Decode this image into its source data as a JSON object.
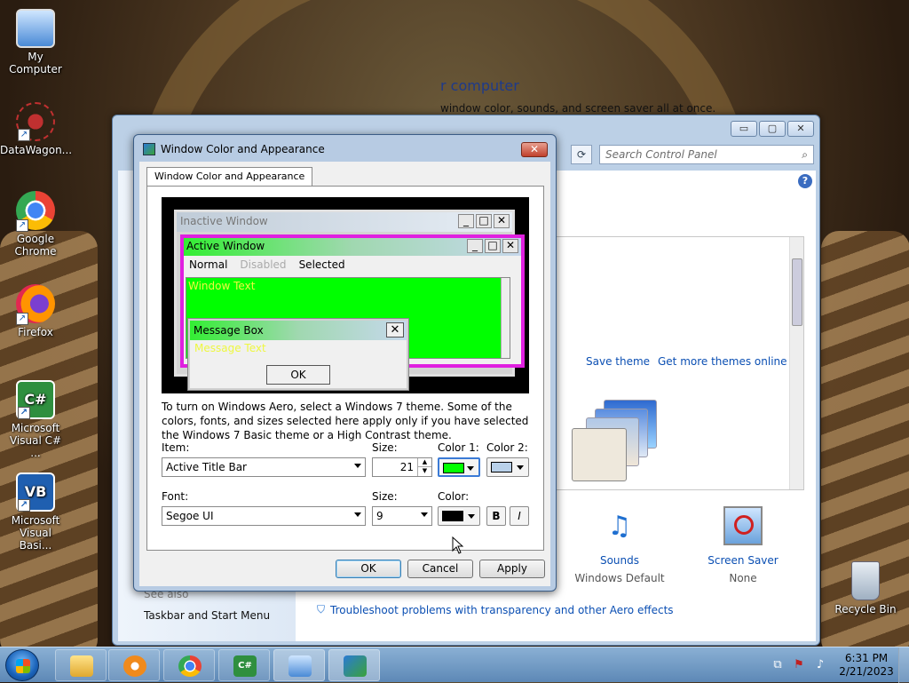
{
  "desktop": {
    "icons": [
      {
        "label": "My Computer"
      },
      {
        "label": "DataWagon..."
      },
      {
        "label": "Google Chrome"
      },
      {
        "label": "Firefox"
      },
      {
        "label": "Microsoft Visual C# ..."
      },
      {
        "label": "Microsoft Visual Basi..."
      },
      {
        "label": "Recycle Bin"
      }
    ]
  },
  "control_panel": {
    "search_placeholder": "Search Control Panel",
    "title_fragment": "r computer",
    "subtitle_fragment": "window color, sounds, and screen saver all at once.",
    "save_theme": "Save theme",
    "get_more_themes": "Get more themes online",
    "sounds_label": "Sounds",
    "sounds_value": "Windows Default",
    "screensaver_label": "Screen Saver",
    "screensaver_value": "None",
    "see_also": "See also",
    "taskbar_link": "Taskbar and Start Menu",
    "troubleshoot": "Troubleshoot problems with transparency and other Aero effects"
  },
  "dialog": {
    "title": "Window Color and Appearance",
    "tab_label": "Window Color and Appearance",
    "preview": {
      "inactive_window": "Inactive Window",
      "active_window": "Active Window",
      "menu_normal": "Normal",
      "menu_disabled": "Disabled",
      "menu_selected": "Selected",
      "window_text": "Window Text",
      "message_box": "Message Box",
      "message_text": "Message Text",
      "ok": "OK"
    },
    "description": "To turn on Windows Aero, select a Windows 7 theme.  Some of the colors, fonts, and sizes selected here apply only if you have selected the Windows 7 Basic theme or a High Contrast theme.",
    "item_label": "Item:",
    "item_value": "Active Title Bar",
    "size_label": "Size:",
    "size_value": "21",
    "color1_label": "Color 1:",
    "color1": "#00ff00",
    "color2_label": "Color 2:",
    "color2": "#b9d1ea",
    "font_label": "Font:",
    "font_value": "Segoe UI",
    "font_size_label": "Size:",
    "font_size_value": "9",
    "font_color_label": "Color:",
    "font_color": "#000000",
    "bold": "B",
    "italic": "I",
    "ok_button": "OK",
    "cancel_button": "Cancel",
    "apply_button": "Apply"
  },
  "taskbar": {
    "time": "6:31 PM",
    "date": "2/21/2023"
  }
}
